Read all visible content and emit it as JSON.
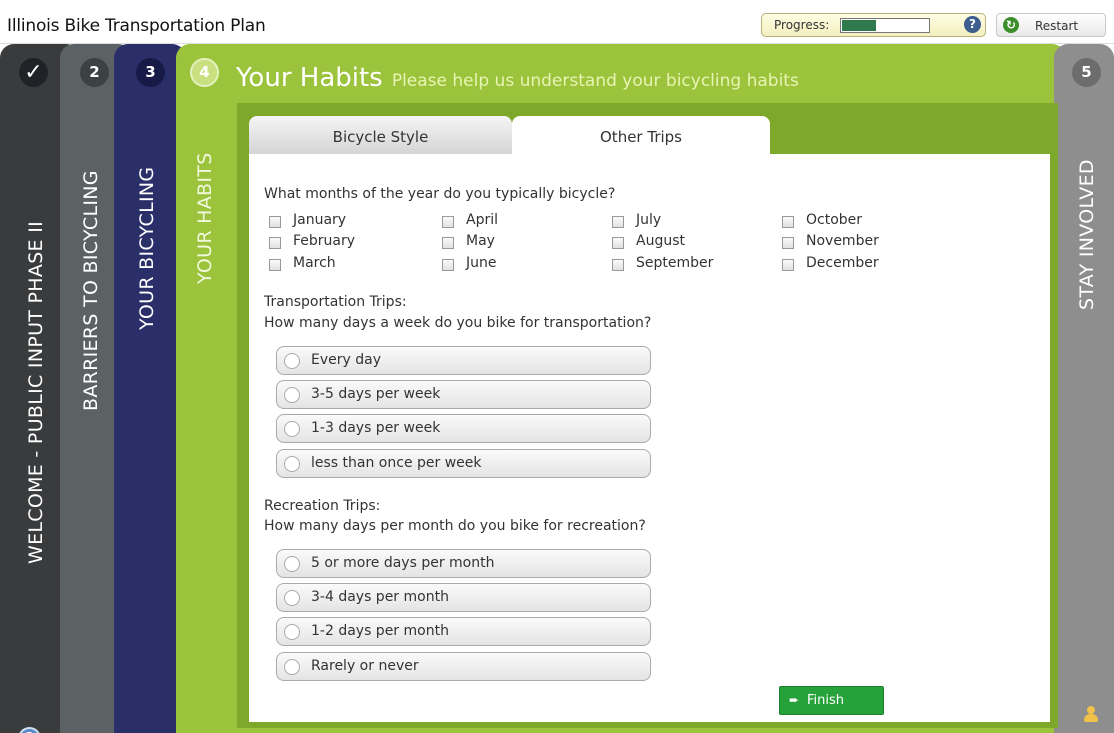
{
  "app": {
    "title": "Illinois Bike Transportation Plan"
  },
  "toolbar": {
    "progress_label": "Progress:",
    "progress_value": 0.4,
    "help_icon": "question-mark",
    "help_glyph": "?",
    "restart_label": "Restart",
    "restart_icon": "refresh"
  },
  "steps": [
    {
      "number": "✓",
      "label": "WELCOME - PUBLIC INPUT PHASE II",
      "color": "#3a3b3d"
    },
    {
      "number": "2",
      "label": "BARRIERS TO BICYCLING",
      "color": "#5c6264"
    },
    {
      "number": "3",
      "label": "YOUR BICYCLING",
      "color": "#2a2f6a"
    },
    {
      "number": "4",
      "label": "YOUR HABITS",
      "color": "#9bc43c"
    },
    {
      "number": "5",
      "label": "STAY INVOLVED",
      "color": "#8e8e8e"
    }
  ],
  "sidebar_help": {
    "label": "help",
    "glyph": "?"
  },
  "main": {
    "title": "Your Habits",
    "subtitle": "Please help us understand your bicycling habits"
  },
  "tabs": [
    {
      "label": "Bicycle Style",
      "active": false
    },
    {
      "label": "Other Trips",
      "active": true
    }
  ],
  "months_question": "What months of the year do you typically bicycle?",
  "months": [
    [
      "January",
      "February",
      "March"
    ],
    [
      "April",
      "May",
      "June"
    ],
    [
      "July",
      "August",
      "September"
    ],
    [
      "October",
      "November",
      "December"
    ]
  ],
  "transport": {
    "heading": "Transportation Trips:",
    "question": "How many days a week do you bike for transportation?",
    "options": [
      "Every day",
      "3-5 days per week",
      "1-3 days per week",
      "less than once per week"
    ]
  },
  "recreation": {
    "heading": "Recreation Trips:",
    "question": "How many days per month do you bike for recreation?",
    "options": [
      "5 or more days per month",
      "3-4 days per month",
      "1-2 days per month",
      "Rarely or never"
    ]
  },
  "finish": {
    "label": "Finish",
    "arrow": "➨",
    "color": "#27a13a"
  },
  "colors": {
    "accent": "#9bc43c",
    "panel": "#7da82a"
  }
}
